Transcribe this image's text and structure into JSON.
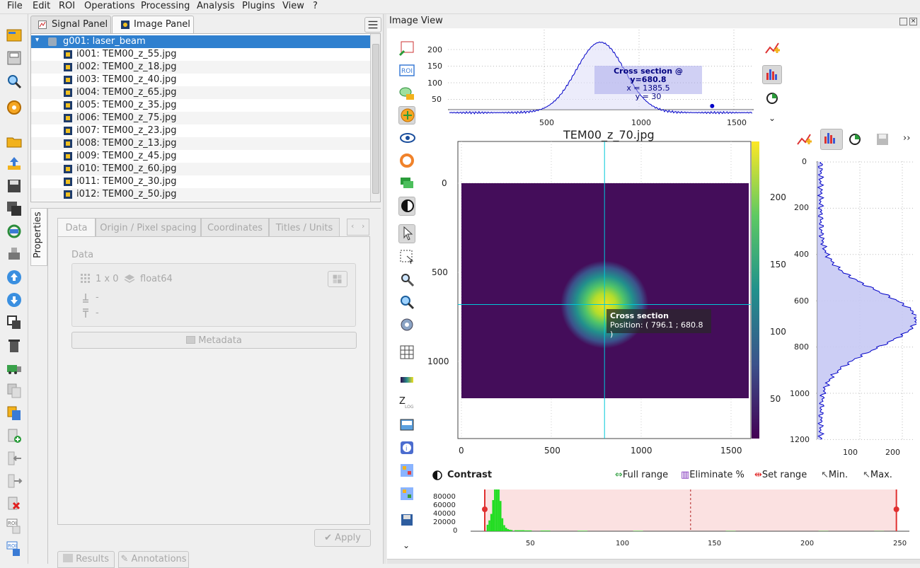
{
  "menu": [
    "File",
    "Edit",
    "ROI",
    "Operations",
    "Processing",
    "Analysis",
    "Plugins",
    "View",
    "?"
  ],
  "tabs": {
    "signal": "Signal Panel",
    "image": "Image Panel"
  },
  "tree": {
    "group": "g001: laser_beam",
    "items": [
      "i001: TEM00_z_55.jpg",
      "i002: TEM00_z_18.jpg",
      "i003: TEM00_z_40.jpg",
      "i004: TEM00_z_65.jpg",
      "i005: TEM00_z_35.jpg",
      "i006: TEM00_z_75.jpg",
      "i007: TEM00_z_23.jpg",
      "i008: TEM00_z_13.jpg",
      "i009: TEM00_z_45.jpg",
      "i010: TEM00_z_60.jpg",
      "i011: TEM00_z_30.jpg",
      "i012: TEM00_z_50.jpg"
    ]
  },
  "properties": {
    "side_tab": "Properties",
    "tabs": [
      "Data",
      "Origin / Pixel spacing",
      "Coordinates",
      "Titles / Units"
    ],
    "group_label": "Data",
    "size": "1 x 0",
    "dtype": "float64",
    "dash1": "-",
    "dash2": "-",
    "metadata_button": "Metadata",
    "apply_button": "Apply",
    "results_button": "Results",
    "annotations_button": "Annotations"
  },
  "image_view": {
    "title": "Image View",
    "plot_title": "TEM00_z_70.jpg",
    "x_ticks": [
      "0",
      "500",
      "1000",
      "1500"
    ],
    "y_ticks": [
      "0",
      "500",
      "1000"
    ],
    "colorbar_ticks": [
      "200",
      "150",
      "100",
      "50"
    ],
    "tooltip": {
      "title": "Cross section",
      "position": "Position: ( 796.1 ; 680.8 )"
    },
    "cross_x": 796.1,
    "cross_y": 680.8
  },
  "xsection": {
    "title": "Cross section @ y=680.8",
    "x_line": "x = 1385.5",
    "y_line": "y = 30",
    "y_ticks": [
      "200",
      "150",
      "100",
      "50"
    ],
    "x_ticks": [
      "500",
      "1000",
      "1500"
    ]
  },
  "ysection": {
    "y_ticks": [
      "0",
      "200",
      "400",
      "600",
      "800",
      "1000",
      "1200"
    ],
    "x_ticks": [
      "100",
      "200"
    ]
  },
  "contrast": {
    "title": "Contrast",
    "full_range": "Full range",
    "eliminate": "Eliminate %",
    "set_range": "Set range",
    "min": "Min.",
    "max": "Max.",
    "y_ticks": [
      "80000",
      "60000",
      "40000",
      "20000",
      "0"
    ],
    "x_ticks": [
      "50",
      "100",
      "150",
      "200",
      "250"
    ],
    "range_min": 20,
    "range_max": 242
  },
  "colors": {
    "selection": "#2f80cf",
    "curve": "#0000c8",
    "cursor": "#00c8d8",
    "histogram": "#22dd22",
    "range": "#e03030"
  }
}
